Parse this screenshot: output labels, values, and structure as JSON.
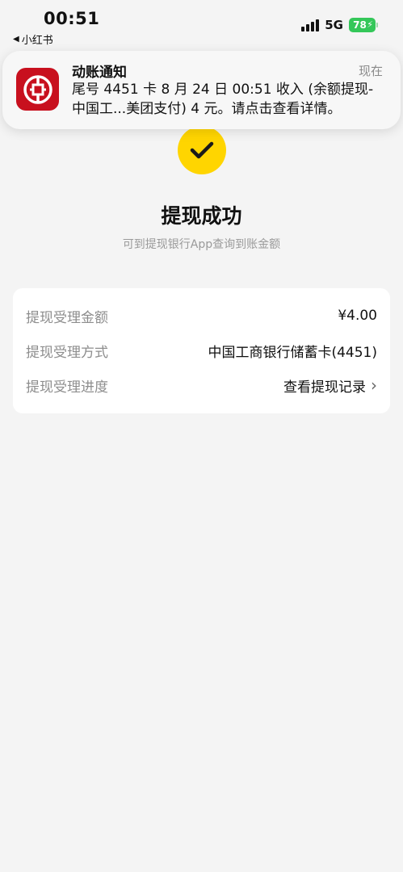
{
  "status_bar": {
    "time": "00:51",
    "back_app": "小红书",
    "network": "5G",
    "battery": "78"
  },
  "notification": {
    "title": "动账通知",
    "time": "现在",
    "body_line1": "尾号 4451 卡 8 月 24 日 00:51 收入 (余额提现-",
    "body_line2": "中国工...美团支付) 4 元。请点击查看详情。",
    "icon": "icbc-logo-icon"
  },
  "result": {
    "title": "提现成功",
    "subtitle": "可到提现银行App查询到账金额"
  },
  "details": {
    "rows": [
      {
        "label": "提现受理金额",
        "value": "¥4.00"
      },
      {
        "label": "提现受理方式",
        "value": "中国工商银行储蓄卡(4451)"
      },
      {
        "label": "提现受理进度",
        "value": "查看提现记录"
      }
    ]
  },
  "colors": {
    "accent": "#ffd500",
    "bank_red": "#c8101e",
    "battery_green": "#34c759"
  }
}
